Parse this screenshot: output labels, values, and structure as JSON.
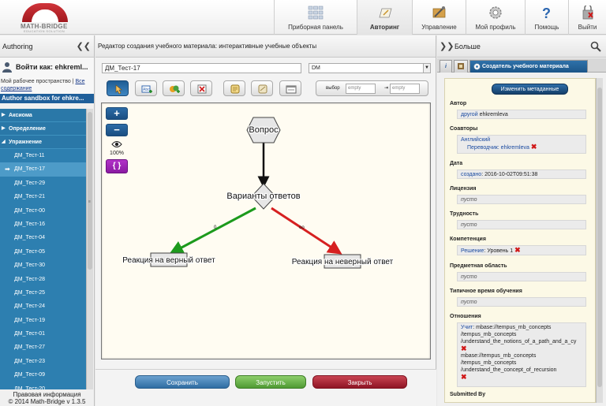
{
  "app": {
    "logo_name": "MATH-BRIDGE",
    "logo_sub": "EDUCATION SOLUTION"
  },
  "topnav": [
    {
      "label": "Приборная панель",
      "icon": "dashboard-icon"
    },
    {
      "label": "Авторинг",
      "icon": "authoring-icon",
      "active": true
    },
    {
      "label": "Управление",
      "icon": "management-icon"
    },
    {
      "label": "Мой профиль",
      "icon": "gear-icon"
    },
    {
      "label": "Помощь",
      "icon": "help-icon"
    },
    {
      "label": "Выйти",
      "icon": "logout-icon"
    }
  ],
  "left": {
    "title": "Authoring",
    "collapse": "❮❮",
    "login": "Войти как: ehkreml...",
    "workspace_prefix": "Мой рабочее пространство | ",
    "workspace_link1": "Все",
    "workspace_link2": "содержание",
    "sandbox": "Author sandbox for ehkre...",
    "sections": [
      {
        "label": "Аксиома",
        "expanded": false
      },
      {
        "label": "Определение",
        "expanded": false
      },
      {
        "label": "Упражнение",
        "expanded": true
      }
    ],
    "items": [
      "ДМ_Тест-11",
      "ДМ_Тест-17",
      "ДМ_Тест-29",
      "ДМ_Тест-21",
      "ДМ_Тест-00",
      "ДМ_Тест-16",
      "ДМ_Тест-04",
      "ДМ_Тест-05",
      "ДМ_Тест-30",
      "ДМ_Тест-28",
      "ДМ_Тест-25",
      "ДМ_Тест-24",
      "ДМ_Тест-19",
      "ДМ_Тест-01",
      "ДМ_Тест-27",
      "ДМ_Тест-23",
      "ДМ_Тест-09",
      "ДМ_Тест-20"
    ],
    "selected_index": 1,
    "footer_line1": "Правовая информация",
    "footer_line2": "© 2014 Math-Bridge v 1.3.5"
  },
  "editor": {
    "title": "Редактор создания учебного материала: интерактивные учебные объекты",
    "name_value": "ДМ_Тест-17",
    "lang_value": "DM",
    "select_label": "выбор",
    "select_from_placeholder": "empty",
    "select_to_placeholder": "empty",
    "zoom_in": "+",
    "zoom_out": "−",
    "zoom_level": "100%",
    "refresh_glyph": "{ }",
    "nodes": {
      "question": "Вопрос",
      "answers": "Варианты ответов",
      "correct": "Реакция на верный ответ",
      "wrong": "Реакция на неверный ответ"
    },
    "edge_labels": {
      "correct": "0",
      "wrong": "oo"
    },
    "colors": {
      "correct_edge": "#1c9a1c",
      "wrong_edge": "#d62020",
      "main_edge": "#111111"
    },
    "save_label": "Сохранить",
    "run_label": "Запустить",
    "close_label": "Закрыть"
  },
  "right": {
    "collapse": "❯❯",
    "title": "Больше",
    "tab_info": "i",
    "tab_active": "Создатель учебного материала",
    "change_meta_btn": "Изменить метаданные",
    "fields": {
      "author_h": "Автор",
      "author_link": "другой",
      "author_val": "ehkremleva",
      "coauthors_h": "Соавторы",
      "coauthor_lang": "Английский",
      "coauthor_role": "Переводчик: ehkremleva",
      "date_h": "Дата",
      "date_link": "создано",
      "date_val": ": 2016-10-02T09:51:38",
      "license_h": "Лицензия",
      "license_val": "пусто",
      "difficulty_h": "Трудность",
      "difficulty_val": "пусто",
      "competence_h": "Компетенция",
      "competence_link": "Решение",
      "competence_val": ": Уровень 1",
      "subject_h": "Предметная область",
      "subject_val": "пусто",
      "time_h": "Типичное время обучения",
      "time_val": "пусто",
      "relations_h": "Отношения",
      "rel_link": "Учит",
      "rel1_l1": ": mbase://tempus_mb_concepts",
      "rel1_l2": "/tempus_mb_concepts",
      "rel1_l3": "/understand_the_notions_of_a_path_and_a_cy",
      "rel2_l1": "mbase://tempus_mb_concepts",
      "rel2_l2": "/tempus_mb_concepts",
      "rel2_l3": "/understand_the_concept_of_recursion",
      "submitted_h": "Submitted By"
    }
  }
}
